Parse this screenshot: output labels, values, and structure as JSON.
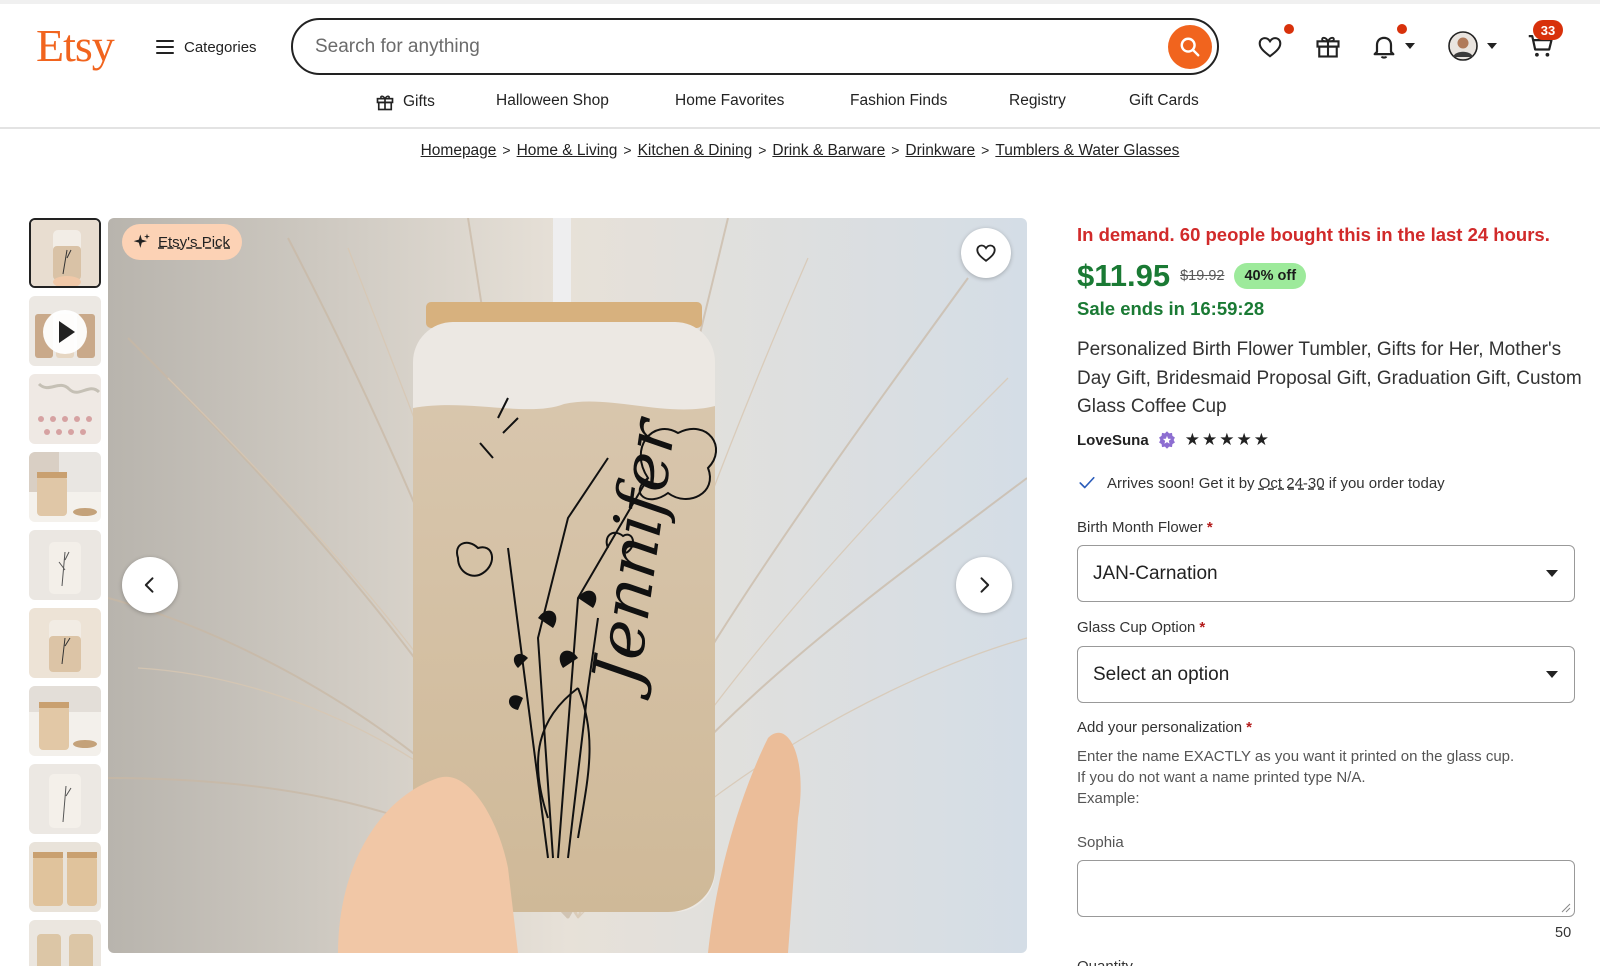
{
  "header": {
    "logo": "Etsy",
    "categories_label": "Categories",
    "search_placeholder": "Search for anything",
    "cart_count": "33",
    "colors": {
      "brand": "#f1641e",
      "badge": "#d8310b"
    }
  },
  "subnav": {
    "items": [
      "Gifts",
      "Halloween Shop",
      "Home Favorites",
      "Fashion Finds",
      "Registry",
      "Gift Cards"
    ]
  },
  "breadcrumb": [
    "Homepage",
    "Home & Living",
    "Kitchen & Dining",
    "Drink & Barware",
    "Drinkware",
    "Tumblers & Water Glasses"
  ],
  "gallery": {
    "badge_label": "Etsy's Pick",
    "cup_name_text": "Jennifer"
  },
  "product": {
    "demand_text": "In demand. 60 people bought this in the last 24 hours.",
    "price": "$11.95",
    "original_price": "$19.92",
    "discount": "40% off",
    "sale_ends": "Sale ends in 16:59:28",
    "title": "Personalized Birth Flower Tumbler, Gifts for Her, Mother's Day Gift, Bridesmaid Proposal Gift, Graduation Gift, Custom Glass Coffee Cup",
    "seller": "LoveSuna",
    "rating_stars": 5,
    "arrives_prefix": "Arrives soon! Get it by",
    "arrives_date": "Oct 24-30",
    "arrives_suffix": "if you order today",
    "colors": {
      "sale_green": "#1a7a34",
      "demand_red": "#d12a2a",
      "discount_bg": "#9dea9b"
    }
  },
  "options": {
    "birth_flower_label": "Birth Month Flower",
    "birth_flower_value": "JAN-Carnation",
    "glass_cup_label": "Glass Cup Option",
    "glass_cup_value": "Select an option",
    "personalization_label": "Add your personalization",
    "personalization_help_1": "Enter the name EXACTLY as you want it printed on the glass cup.",
    "personalization_help_2": "If you do not want a name printed type N/A.",
    "personalization_help_3": "Example:",
    "personalization_example": "Sophia",
    "char_counter": "50",
    "quantity_label": "Quantity"
  }
}
